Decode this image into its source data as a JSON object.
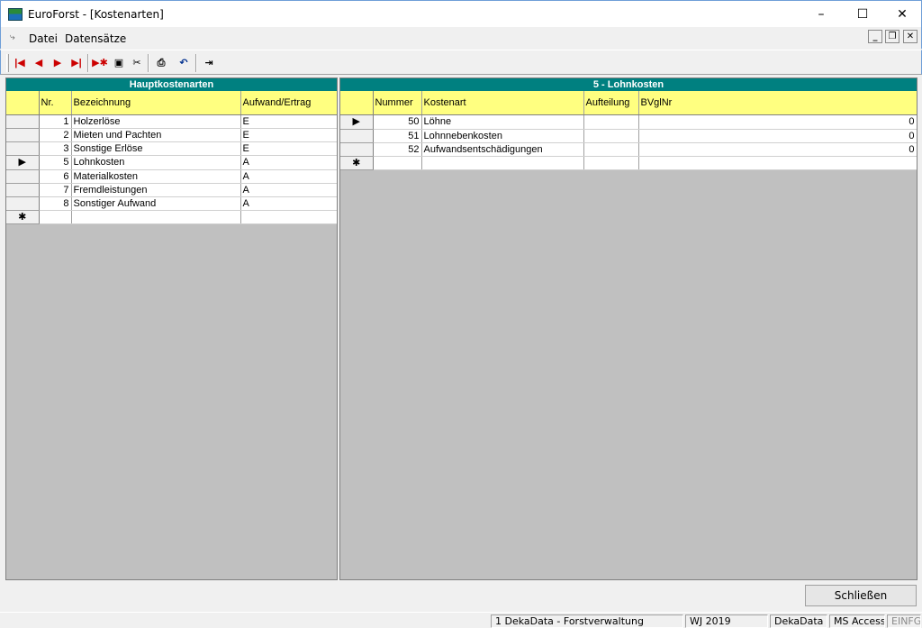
{
  "window": {
    "title": "EuroForst - [Kostenarten]",
    "minimize": "–",
    "maximize": "☐",
    "close": "✕"
  },
  "menu": {
    "items": [
      "Datei",
      "Datensätze"
    ],
    "mdi_minimize": "_",
    "mdi_restore": "❐",
    "mdi_close": "✕"
  },
  "toolbar": {
    "icons": [
      "first-record-icon",
      "prev-record-icon",
      "next-record-icon",
      "last-record-icon",
      "new-record-icon",
      "save-icon",
      "delete-icon",
      "print-icon",
      "undo-icon",
      "exit-icon"
    ]
  },
  "left_panel": {
    "title": "Hauptkostenarten",
    "columns": [
      "Nr.",
      "Bezeichnung",
      "Aufwand/Ertrag"
    ],
    "rows": [
      {
        "nr": "1",
        "bezeichnung": "Holzerlöse",
        "art": "E"
      },
      {
        "nr": "2",
        "bezeichnung": "Mieten und Pachten",
        "art": "E"
      },
      {
        "nr": "3",
        "bezeichnung": "Sonstige Erlöse",
        "art": "E"
      },
      {
        "nr": "5",
        "bezeichnung": "Lohnkosten",
        "art": "A"
      },
      {
        "nr": "6",
        "bezeichnung": "Materialkosten",
        "art": "A"
      },
      {
        "nr": "7",
        "bezeichnung": "Fremdleistungen",
        "art": "A"
      },
      {
        "nr": "8",
        "bezeichnung": "Sonstiger Aufwand",
        "art": "A"
      }
    ],
    "current_row_marker": "▶",
    "new_row_marker": "✱"
  },
  "right_panel": {
    "title": "5 - Lohnkosten",
    "columns": [
      "Nummer",
      "Kostenart",
      "Aufteilung",
      "BVglNr"
    ],
    "rows": [
      {
        "nummer": "50",
        "kostenart": "Löhne",
        "aufteilung": "",
        "bvglnr": "0"
      },
      {
        "nummer": "51",
        "kostenart": "Lohnnebenkosten",
        "aufteilung": "",
        "bvglnr": "0"
      },
      {
        "nummer": "52",
        "kostenart": "Aufwandsentschädigungen",
        "aufteilung": "",
        "bvglnr": "0"
      }
    ],
    "current_row_marker": "▶",
    "new_row_marker": "✱"
  },
  "close_button": "Schließen",
  "status": {
    "company": "1 DekaData - Forstverwaltung",
    "year": "WJ 2019",
    "vendor": "DekaData",
    "db": "MS Access",
    "mode": "EINFG"
  }
}
